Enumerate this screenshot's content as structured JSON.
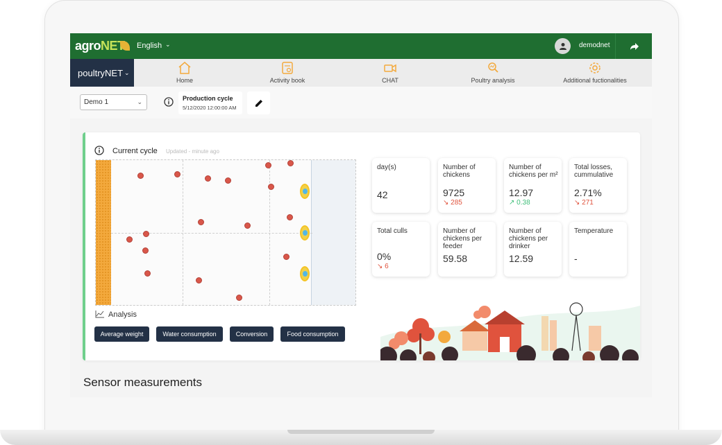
{
  "header": {
    "logo_main": "agro",
    "logo_net": "NET",
    "language": "English",
    "username": "demodnet"
  },
  "app_selector": "poultryNET",
  "nav": [
    {
      "label": "Home",
      "icon": "home-icon"
    },
    {
      "label": "Activity book",
      "icon": "activity-book-icon"
    },
    {
      "label": "CHAT",
      "icon": "video-chat-icon"
    },
    {
      "label": "Poultry analysis",
      "icon": "poultry-analysis-icon"
    },
    {
      "label": "Additional fuctionalities",
      "icon": "gear-icon"
    }
  ],
  "cycle": {
    "selected": "Demo 1",
    "production_title": "Production cycle",
    "production_date": "5/12/2020 12:00:00 AM"
  },
  "current_cycle": {
    "title": "Current cycle",
    "updated": "Updated - minute ago",
    "analysis_label": "Analysis",
    "buttons": [
      "Average weight",
      "Water consumption",
      "Conversion",
      "Food consumption"
    ]
  },
  "stats": [
    {
      "label": "day(s)",
      "value": "42",
      "delta": "",
      "trend": ""
    },
    {
      "label": "Number of chickens",
      "value": "9725",
      "delta": "285",
      "trend": "down"
    },
    {
      "label": "Number of chickens per m²",
      "value": "12.97",
      "delta": "0.38",
      "trend": "up"
    },
    {
      "label": "Total losses, cummulative",
      "value": "2.71%",
      "delta": "271",
      "trend": "down"
    },
    {
      "label": "Total culls",
      "value": "0%",
      "delta": "6",
      "trend": "down"
    },
    {
      "label": "Number of chickens per feeder",
      "value": "59.58",
      "delta": "",
      "trend": ""
    },
    {
      "label": "Number of chickens per drinker",
      "value": "12.59",
      "delta": "",
      "trend": ""
    },
    {
      "label": "Temperature",
      "value": "-",
      "delta": "",
      "trend": ""
    }
  ],
  "sensor_title": "Sensor measurements",
  "colors": {
    "brand_green": "#1f6e31",
    "navy": "#233146",
    "accent_orange": "#f3a93d",
    "down": "#e0533d",
    "up": "#3fbf7a"
  }
}
